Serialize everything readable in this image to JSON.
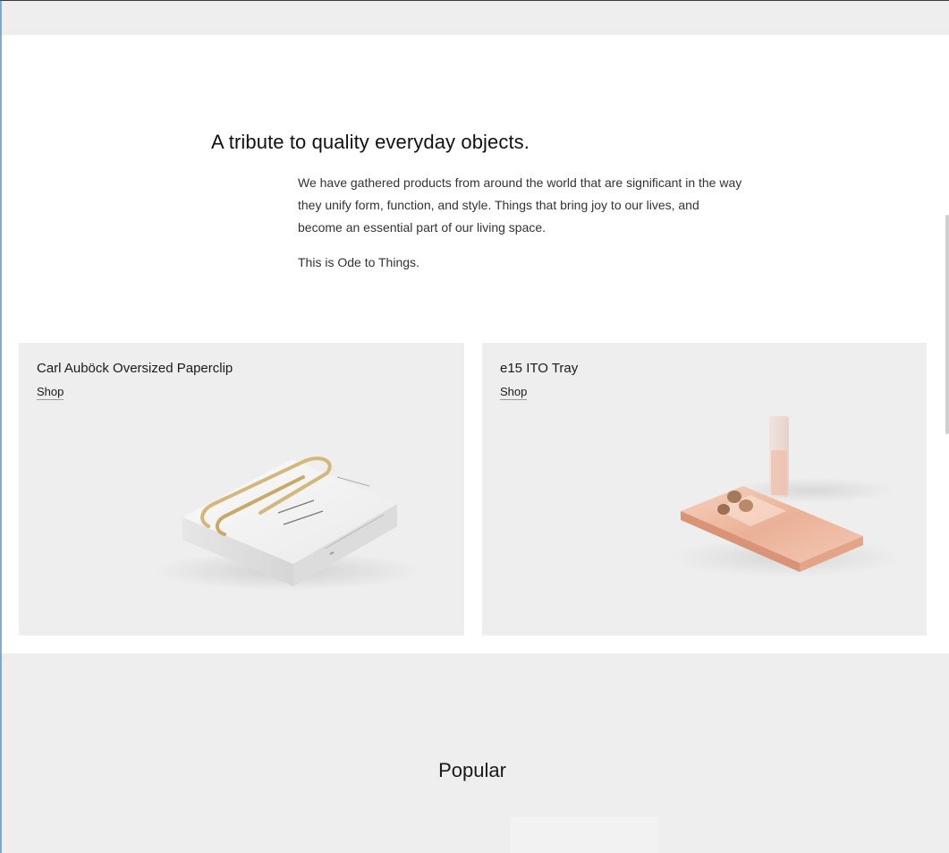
{
  "intro": {
    "title": "A tribute to quality everyday objects.",
    "body": "We have gathered products from around the world that are significant in the way they unify form, function, and style. Things that bring joy to our lives, and become an essential part of our living space.",
    "closing": "This is Ode to Things."
  },
  "featured": [
    {
      "title": "Carl Auböck Oversized Paperclip",
      "link_label": "Shop",
      "image": "paperclip-on-book-image"
    },
    {
      "title": "e15 ITO Tray",
      "link_label": "Shop",
      "image": "copper-tray-image"
    }
  ],
  "popular": {
    "title": "Popular"
  },
  "colors": {
    "page_background": "#eeeeee",
    "section_background": "#ffffff",
    "card_background": "#eeeeee",
    "text": "#1a1a1a",
    "copper": "#e9a98c",
    "brass": "#d4b77a"
  }
}
